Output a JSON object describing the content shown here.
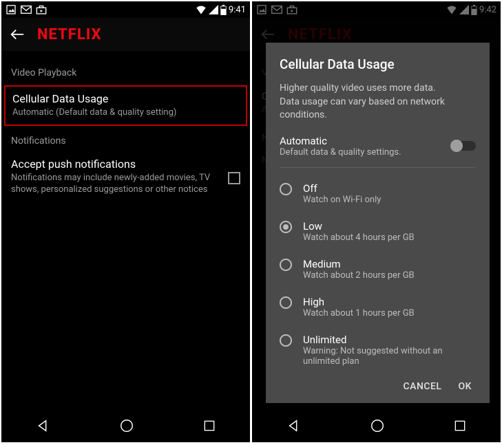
{
  "left": {
    "time": "9:41",
    "brand": "NETFLIX",
    "section1": "Video Playback",
    "cdu_title": "Cellular Data Usage",
    "cdu_sub": "Automatic (Default data & quality setting)",
    "section2": "Notifications",
    "push_title": "Accept push notifications",
    "push_sub": "Notifications may include newly-added movies, TV shows, personalized suggestions or other notices"
  },
  "right": {
    "time": "9:42",
    "brand": "NETFLIX",
    "section1": "V",
    "cdu_title_bg": "C",
    "cdu_sub_bg": "A",
    "section2_bg": "N",
    "push_sub_bg": "N\ns",
    "dialog": {
      "title": "Cellular Data Usage",
      "desc": "Higher quality video uses more data.\nData usage can vary based on network conditions.",
      "auto_label": "Automatic",
      "auto_sub": "Default data & quality settings.",
      "options": [
        {
          "label": "Off",
          "sub": "Watch on Wi-Fi only",
          "selected": false
        },
        {
          "label": "Low",
          "sub": "Watch about 4 hours per GB",
          "selected": true
        },
        {
          "label": "Medium",
          "sub": "Watch about 2 hours per GB",
          "selected": false
        },
        {
          "label": "High",
          "sub": "Watch about 1 hours per GB",
          "selected": false
        },
        {
          "label": "Unlimited",
          "sub": "Warning: Not suggested without an unlimited plan",
          "selected": false
        }
      ],
      "cancel": "CANCEL",
      "ok": "OK"
    }
  }
}
